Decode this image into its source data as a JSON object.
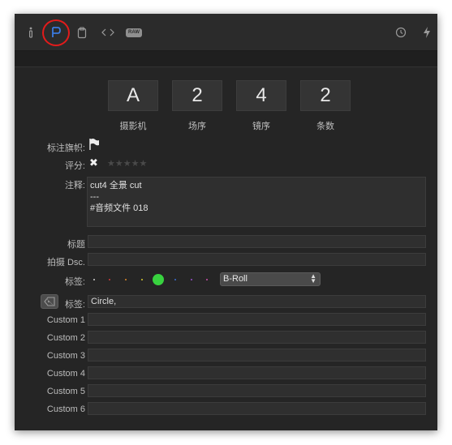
{
  "toolbar": {
    "left_icons": [
      "info-icon",
      "flag-p-icon",
      "clipboard-icon",
      "code-brackets-icon",
      "raw-badge-icon"
    ],
    "raw_badge": "RAW",
    "right_icons": [
      "clock-icon",
      "lightning-icon"
    ]
  },
  "cards": [
    {
      "value": "A",
      "label": "摄影机"
    },
    {
      "value": "2",
      "label": "场序"
    },
    {
      "value": "4",
      "label": "镜序"
    },
    {
      "value": "2",
      "label": "条数"
    }
  ],
  "flag": {
    "label": "标注旗帜:"
  },
  "rating": {
    "label": "评分:",
    "reject_glyph": "✖",
    "stars": "★★★★★"
  },
  "notes": {
    "label": "注释:",
    "text": "cut4 全景 cut\n---\n#音频文件 018"
  },
  "title": {
    "label": "标题",
    "value": ""
  },
  "shoot_desc": {
    "label": "拍摄 Dsc.",
    "value": ""
  },
  "color_labels": {
    "label": "标签:",
    "dot_colors": [
      "#d0d0d0",
      "#d23b3b",
      "#e08a2a",
      "#d9cc2e",
      "#38d23f",
      "#3b6fd6",
      "#9a4fd0",
      "#d04fb0"
    ],
    "selected_color": "#38d23f",
    "selected_value": "B-Roll"
  },
  "keywords": {
    "label": "标签:",
    "value": "Circle,"
  },
  "custom_fields": [
    {
      "label": "Custom 1",
      "value": ""
    },
    {
      "label": "Custom 2",
      "value": ""
    },
    {
      "label": "Custom 3",
      "value": ""
    },
    {
      "label": "Custom 4",
      "value": ""
    },
    {
      "label": "Custom 5",
      "value": ""
    },
    {
      "label": "Custom 6",
      "value": ""
    }
  ],
  "colors": {
    "highlight_ring": "#e21b1b",
    "flag_p_icon": "#3a7be0",
    "panel_bg": "#252525"
  }
}
